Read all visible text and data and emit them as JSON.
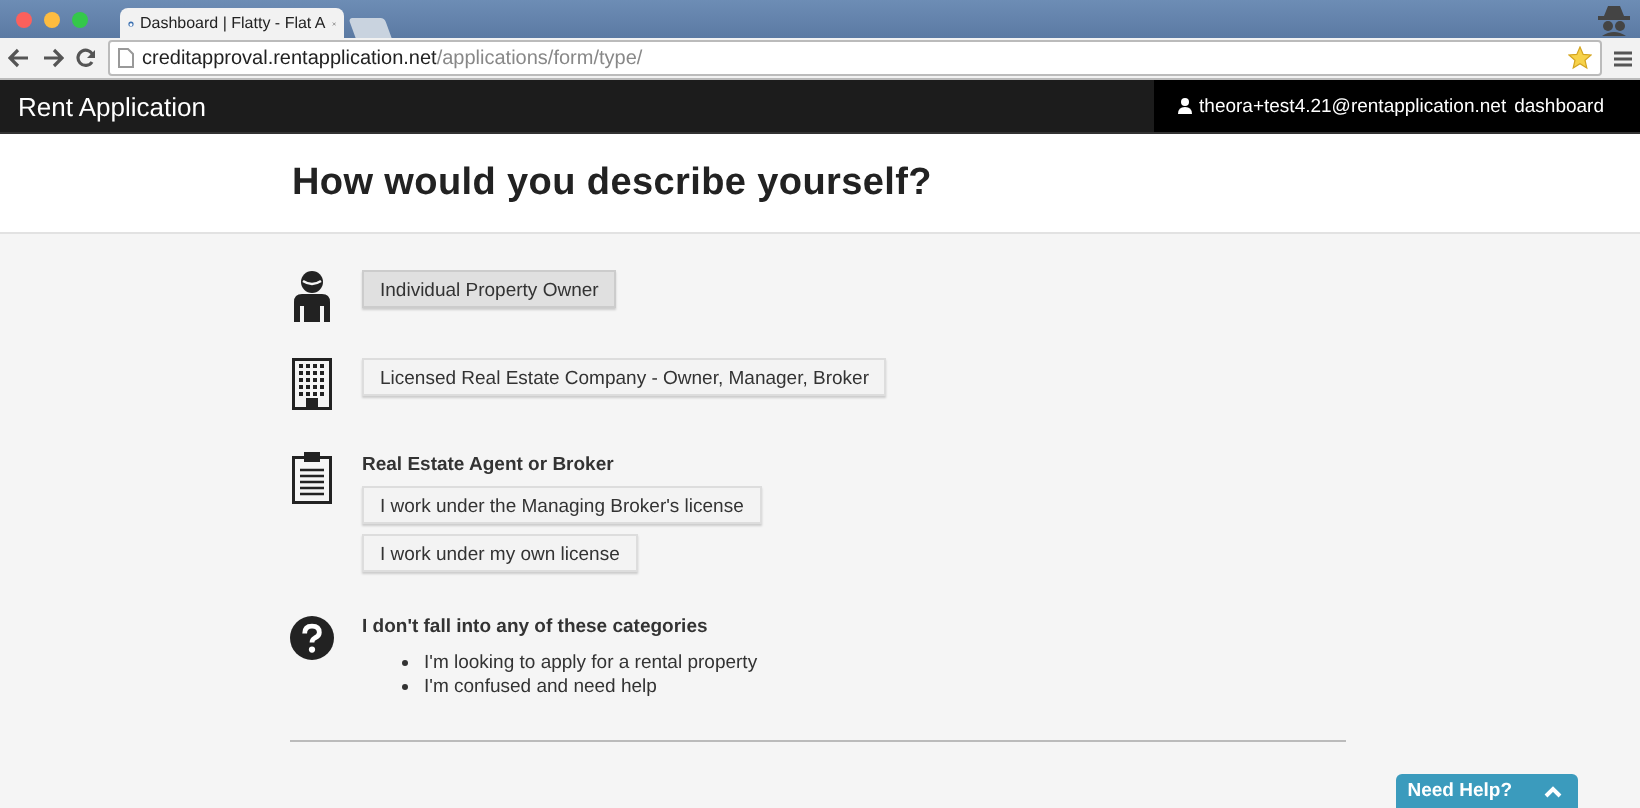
{
  "browser": {
    "tab_title": "Dashboard | Flatty - Flat A",
    "url_host": "creditapproval.rentapplication.net",
    "url_path": "/applications/form/type/"
  },
  "navbar": {
    "brand": "Rent Application",
    "user": "theora+test4.21@rentapplication.net",
    "link": "dashboard"
  },
  "page": {
    "title": "How would you describe yourself?"
  },
  "sections": [
    {
      "options": [
        {
          "label": "Individual Property Owner",
          "selected": true
        }
      ]
    },
    {
      "options": [
        {
          "label": "Licensed Real Estate Company - Owner, Manager, Broker",
          "selected": false
        }
      ]
    },
    {
      "heading": "Real Estate Agent or Broker",
      "options": [
        {
          "label": "I work under the Managing Broker's license",
          "selected": false
        },
        {
          "label": "I work under my own license",
          "selected": false
        }
      ]
    },
    {
      "heading": "I don't fall into any of these categories",
      "links": [
        "I'm looking to apply for a rental property",
        "I'm confused and need help"
      ]
    }
  ],
  "help": {
    "label": "Need Help?"
  }
}
